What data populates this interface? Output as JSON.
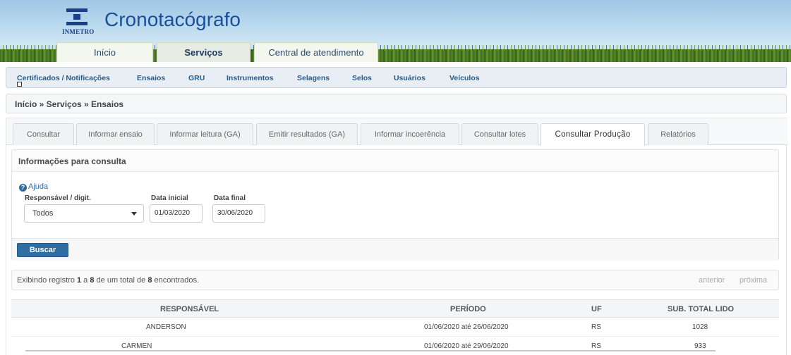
{
  "header": {
    "logo_text": "INMETRO",
    "app_title": "Cronotacógrafo",
    "main_tabs": [
      {
        "label": "Início"
      },
      {
        "label": "Serviços"
      },
      {
        "label": "Central de atendimento"
      }
    ]
  },
  "subnav": {
    "items": [
      {
        "label": "Certificados / Notificações"
      },
      {
        "label": "Ensaios"
      },
      {
        "label": "GRU"
      },
      {
        "label": "Instrumentos"
      },
      {
        "label": "Selagens"
      },
      {
        "label": "Selos"
      },
      {
        "label": "Usuários"
      },
      {
        "label": "Veículos"
      }
    ]
  },
  "breadcrumb": "Início » Serviços » Ensaios",
  "tabs": [
    {
      "label": "Consultar"
    },
    {
      "label": "Informar ensaio"
    },
    {
      "label": "Informar leitura (GA)"
    },
    {
      "label": "Emitir resultados (GA)"
    },
    {
      "label": "Informar incoerência"
    },
    {
      "label": "Consultar lotes"
    },
    {
      "label": "Consultar Produção"
    },
    {
      "label": "Relatórios"
    }
  ],
  "form": {
    "title": "Informações para consulta",
    "help_label": "Ajuda",
    "responsavel_label": "Responsável / digit.",
    "responsavel_value": "Todos",
    "data_inicial_label": "Data inicial",
    "data_inicial_value": "01/03/2020",
    "data_final_label": "Data final",
    "data_final_value": "30/06/2020",
    "buscar_label": "Buscar"
  },
  "pager": {
    "prefix": "Exibindo registro ",
    "from": "1",
    "mid1": " a ",
    "to": "8",
    "mid2": " de um total de ",
    "total": "8",
    "suffix": " encontrados.",
    "prev_label": "anterior",
    "next_label": "próxima"
  },
  "table": {
    "columns": [
      "RESPONSÁVEL",
      "PERÍODO",
      "UF",
      "SUB. TOTAL LIDO"
    ],
    "rows": [
      {
        "responsavel": "ANDERSON",
        "periodo": "01/06/2020 até 26/06/2020",
        "uf": "RS",
        "subtotal": "1028"
      },
      {
        "responsavel": "CARMEN",
        "periodo": "01/06/2020 até 29/06/2020",
        "uf": "RS",
        "subtotal": "933"
      }
    ]
  }
}
